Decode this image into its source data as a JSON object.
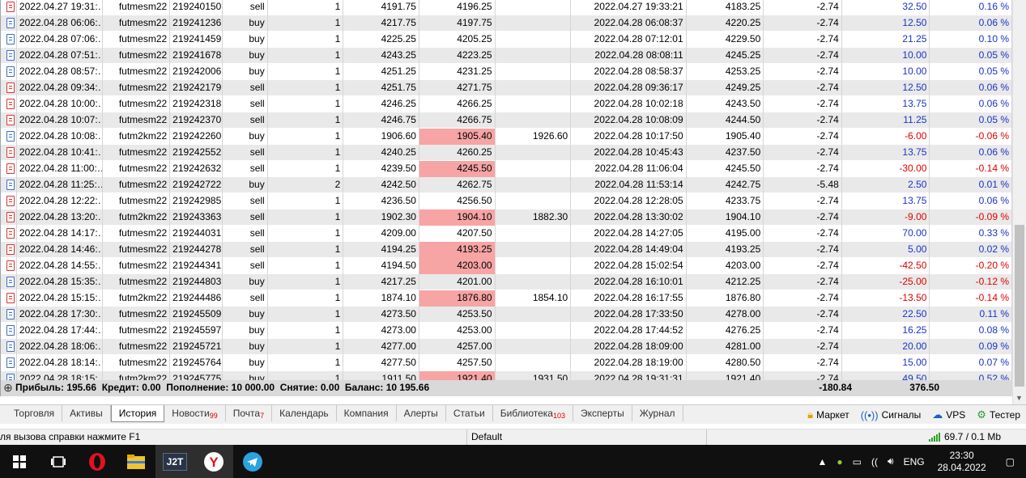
{
  "history": {
    "rows": [
      {
        "open_time": "2022.04.27 19:31:…",
        "symbol": "futmesm22",
        "ticket": "219240150",
        "type": "sell",
        "volume": "1",
        "price": "4191.75",
        "sl": "4196.25",
        "tp": "",
        "close_time": "2022.04.27 19:33:21",
        "close_price": "4183.25",
        "commission": "-2.74",
        "profit": "32.50",
        "pct": "0.16 %",
        "sl_hl": false,
        "sign": "pos"
      },
      {
        "open_time": "2022.04.28 06:06:…",
        "symbol": "futmesm22",
        "ticket": "219241236",
        "type": "buy",
        "volume": "1",
        "price": "4217.75",
        "sl": "4197.75",
        "tp": "",
        "close_time": "2022.04.28 06:08:37",
        "close_price": "4220.25",
        "commission": "-2.74",
        "profit": "12.50",
        "pct": "0.06 %",
        "sl_hl": false,
        "sign": "pos"
      },
      {
        "open_time": "2022.04.28 07:06:…",
        "symbol": "futmesm22",
        "ticket": "219241459",
        "type": "buy",
        "volume": "1",
        "price": "4225.25",
        "sl": "4205.25",
        "tp": "",
        "close_time": "2022.04.28 07:12:01",
        "close_price": "4229.50",
        "commission": "-2.74",
        "profit": "21.25",
        "pct": "0.10 %",
        "sl_hl": false,
        "sign": "pos"
      },
      {
        "open_time": "2022.04.28 07:51:…",
        "symbol": "futmesm22",
        "ticket": "219241678",
        "type": "buy",
        "volume": "1",
        "price": "4243.25",
        "sl": "4223.25",
        "tp": "",
        "close_time": "2022.04.28 08:08:11",
        "close_price": "4245.25",
        "commission": "-2.74",
        "profit": "10.00",
        "pct": "0.05 %",
        "sl_hl": false,
        "sign": "pos"
      },
      {
        "open_time": "2022.04.28 08:57:…",
        "symbol": "futmesm22",
        "ticket": "219242006",
        "type": "buy",
        "volume": "1",
        "price": "4251.25",
        "sl": "4231.25",
        "tp": "",
        "close_time": "2022.04.28 08:58:37",
        "close_price": "4253.25",
        "commission": "-2.74",
        "profit": "10.00",
        "pct": "0.05 %",
        "sl_hl": false,
        "sign": "pos"
      },
      {
        "open_time": "2022.04.28 09:34:…",
        "symbol": "futmesm22",
        "ticket": "219242179",
        "type": "sell",
        "volume": "1",
        "price": "4251.75",
        "sl": "4271.75",
        "tp": "",
        "close_time": "2022.04.28 09:36:17",
        "close_price": "4249.25",
        "commission": "-2.74",
        "profit": "12.50",
        "pct": "0.06 %",
        "sl_hl": false,
        "sign": "pos"
      },
      {
        "open_time": "2022.04.28 10:00:…",
        "symbol": "futmesm22",
        "ticket": "219242318",
        "type": "sell",
        "volume": "1",
        "price": "4246.25",
        "sl": "4266.25",
        "tp": "",
        "close_time": "2022.04.28 10:02:18",
        "close_price": "4243.50",
        "commission": "-2.74",
        "profit": "13.75",
        "pct": "0.06 %",
        "sl_hl": false,
        "sign": "pos"
      },
      {
        "open_time": "2022.04.28 10:07:…",
        "symbol": "futmesm22",
        "ticket": "219242370",
        "type": "sell",
        "volume": "1",
        "price": "4246.75",
        "sl": "4266.75",
        "tp": "",
        "close_time": "2022.04.28 10:08:09",
        "close_price": "4244.50",
        "commission": "-2.74",
        "profit": "11.25",
        "pct": "0.05 %",
        "sl_hl": false,
        "sign": "pos"
      },
      {
        "open_time": "2022.04.28 10:08:…",
        "symbol": "futm2km22",
        "ticket": "219242260",
        "type": "buy",
        "volume": "1",
        "price": "1906.60",
        "sl": "1905.40",
        "tp": "1926.60",
        "close_time": "2022.04.28 10:17:50",
        "close_price": "1905.40",
        "commission": "-2.74",
        "profit": "-6.00",
        "pct": "-0.06 %",
        "sl_hl": true,
        "sign": "neg"
      },
      {
        "open_time": "2022.04.28 10:41:…",
        "symbol": "futmesm22",
        "ticket": "219242552",
        "type": "sell",
        "volume": "1",
        "price": "4240.25",
        "sl": "4260.25",
        "tp": "",
        "close_time": "2022.04.28 10:45:43",
        "close_price": "4237.50",
        "commission": "-2.74",
        "profit": "13.75",
        "pct": "0.06 %",
        "sl_hl": false,
        "sign": "pos"
      },
      {
        "open_time": "2022.04.28 11:00:…",
        "symbol": "futmesm22",
        "ticket": "219242632",
        "type": "sell",
        "volume": "1",
        "price": "4239.50",
        "sl": "4245.50",
        "tp": "",
        "close_time": "2022.04.28 11:06:04",
        "close_price": "4245.50",
        "commission": "-2.74",
        "profit": "-30.00",
        "pct": "-0.14 %",
        "sl_hl": true,
        "sign": "neg"
      },
      {
        "open_time": "2022.04.28 11:25:…",
        "symbol": "futmesm22",
        "ticket": "219242722",
        "type": "buy",
        "volume": "2",
        "price": "4242.50",
        "sl": "4262.75",
        "tp": "",
        "close_time": "2022.04.28 11:53:14",
        "close_price": "4242.75",
        "commission": "-5.48",
        "profit": "2.50",
        "pct": "0.01 %",
        "sl_hl": false,
        "sign": "pos"
      },
      {
        "open_time": "2022.04.28 12:22:…",
        "symbol": "futmesm22",
        "ticket": "219242985",
        "type": "sell",
        "volume": "1",
        "price": "4236.50",
        "sl": "4256.50",
        "tp": "",
        "close_time": "2022.04.28 12:28:05",
        "close_price": "4233.75",
        "commission": "-2.74",
        "profit": "13.75",
        "pct": "0.06 %",
        "sl_hl": false,
        "sign": "pos"
      },
      {
        "open_time": "2022.04.28 13:20:…",
        "symbol": "futm2km22",
        "ticket": "219243363",
        "type": "sell",
        "volume": "1",
        "price": "1902.30",
        "sl": "1904.10",
        "tp": "1882.30",
        "close_time": "2022.04.28 13:30:02",
        "close_price": "1904.10",
        "commission": "-2.74",
        "profit": "-9.00",
        "pct": "-0.09 %",
        "sl_hl": true,
        "sign": "neg"
      },
      {
        "open_time": "2022.04.28 14:17:…",
        "symbol": "futmesm22",
        "ticket": "219244031",
        "type": "sell",
        "volume": "1",
        "price": "4209.00",
        "sl": "4207.50",
        "tp": "",
        "close_time": "2022.04.28 14:27:05",
        "close_price": "4195.00",
        "commission": "-2.74",
        "profit": "70.00",
        "pct": "0.33 %",
        "sl_hl": false,
        "sign": "pos"
      },
      {
        "open_time": "2022.04.28 14:46:…",
        "symbol": "futmesm22",
        "ticket": "219244278",
        "type": "sell",
        "volume": "1",
        "price": "4194.25",
        "sl": "4193.25",
        "tp": "",
        "close_time": "2022.04.28 14:49:04",
        "close_price": "4193.25",
        "commission": "-2.74",
        "profit": "5.00",
        "pct": "0.02 %",
        "sl_hl": true,
        "sign": "pos"
      },
      {
        "open_time": "2022.04.28 14:55:…",
        "symbol": "futmesm22",
        "ticket": "219244341",
        "type": "sell",
        "volume": "1",
        "price": "4194.50",
        "sl": "4203.00",
        "tp": "",
        "close_time": "2022.04.28 15:02:54",
        "close_price": "4203.00",
        "commission": "-2.74",
        "profit": "-42.50",
        "pct": "-0.20 %",
        "sl_hl": true,
        "sign": "neg"
      },
      {
        "open_time": "2022.04.28 15:35:…",
        "symbol": "futmesm22",
        "ticket": "219244803",
        "type": "buy",
        "volume": "1",
        "price": "4217.25",
        "sl": "4201.00",
        "tp": "",
        "close_time": "2022.04.28 16:10:01",
        "close_price": "4212.25",
        "commission": "-2.74",
        "profit": "-25.00",
        "pct": "-0.12 %",
        "sl_hl": false,
        "sign": "neg"
      },
      {
        "open_time": "2022.04.28 15:15:…",
        "symbol": "futm2km22",
        "ticket": "219244486",
        "type": "sell",
        "volume": "1",
        "price": "1874.10",
        "sl": "1876.80",
        "tp": "1854.10",
        "close_time": "2022.04.28 16:17:55",
        "close_price": "1876.80",
        "commission": "-2.74",
        "profit": "-13.50",
        "pct": "-0.14 %",
        "sl_hl": true,
        "sign": "neg"
      },
      {
        "open_time": "2022.04.28 17:30:…",
        "symbol": "futmesm22",
        "ticket": "219245509",
        "type": "buy",
        "volume": "1",
        "price": "4273.50",
        "sl": "4253.50",
        "tp": "",
        "close_time": "2022.04.28 17:33:50",
        "close_price": "4278.00",
        "commission": "-2.74",
        "profit": "22.50",
        "pct": "0.11 %",
        "sl_hl": false,
        "sign": "pos"
      },
      {
        "open_time": "2022.04.28 17:44:…",
        "symbol": "futmesm22",
        "ticket": "219245597",
        "type": "buy",
        "volume": "1",
        "price": "4273.00",
        "sl": "4253.00",
        "tp": "",
        "close_time": "2022.04.28 17:44:52",
        "close_price": "4276.25",
        "commission": "-2.74",
        "profit": "16.25",
        "pct": "0.08 %",
        "sl_hl": false,
        "sign": "pos"
      },
      {
        "open_time": "2022.04.28 18:06:…",
        "symbol": "futmesm22",
        "ticket": "219245721",
        "type": "buy",
        "volume": "1",
        "price": "4277.00",
        "sl": "4257.00",
        "tp": "",
        "close_time": "2022.04.28 18:09:00",
        "close_price": "4281.00",
        "commission": "-2.74",
        "profit": "20.00",
        "pct": "0.09 %",
        "sl_hl": false,
        "sign": "pos"
      },
      {
        "open_time": "2022.04.28 18:14:…",
        "symbol": "futmesm22",
        "ticket": "219245764",
        "type": "buy",
        "volume": "1",
        "price": "4277.50",
        "sl": "4257.50",
        "tp": "",
        "close_time": "2022.04.28 18:19:00",
        "close_price": "4280.50",
        "commission": "-2.74",
        "profit": "15.00",
        "pct": "0.07 %",
        "sl_hl": false,
        "sign": "pos"
      },
      {
        "open_time": "2022.04.28 18:15:…",
        "symbol": "futm2km22",
        "ticket": "219245775",
        "type": "buy",
        "volume": "1",
        "price": "1911.50",
        "sl": "1921.40",
        "tp": "1931.50",
        "close_time": "2022.04.28 19:31:31",
        "close_price": "1921.40",
        "commission": "-2.74",
        "profit": "49.50",
        "pct": "0.52 %",
        "sl_hl": true,
        "sign": "pos"
      }
    ]
  },
  "summary": {
    "text": "Прибыль: 195.66  Кредит: 0.00  Пополнение: 10 000.00  Снятие: 0.00  Баланс: 10 195.66",
    "commission_total": "-180.84",
    "profit_total": "376.50"
  },
  "tabs": [
    {
      "label": "Торговля",
      "badge": ""
    },
    {
      "label": "Активы",
      "badge": ""
    },
    {
      "label": "История",
      "badge": "",
      "active": true
    },
    {
      "label": "Новости",
      "badge": "99"
    },
    {
      "label": "Почта",
      "badge": "7"
    },
    {
      "label": "Календарь",
      "badge": ""
    },
    {
      "label": "Компания",
      "badge": ""
    },
    {
      "label": "Алерты",
      "badge": ""
    },
    {
      "label": "Статьи",
      "badge": ""
    },
    {
      "label": "Библиотека",
      "badge": "103"
    },
    {
      "label": "Эксперты",
      "badge": ""
    },
    {
      "label": "Журнал",
      "badge": ""
    }
  ],
  "tools": {
    "market": "Маркет",
    "signals": "Сигналы",
    "vps": "VPS",
    "tester": "Тестер"
  },
  "statusbar": {
    "help": "ля вызова справки нажмите F1",
    "profile": "Default",
    "traffic": "69.7 / 0.1 Mb"
  },
  "taskbar": {
    "apps": [
      "start",
      "task-view",
      "opera",
      "file-explorer",
      "j2t",
      "yandex",
      "telegram"
    ],
    "j2t_label": "J2T",
    "lang": "ENG",
    "time": "23:30",
    "date": "28.04.2022"
  },
  "colors": {
    "positive": "#1933c7",
    "negative": "#e00000",
    "stop_hit": "#f7a4a4"
  }
}
